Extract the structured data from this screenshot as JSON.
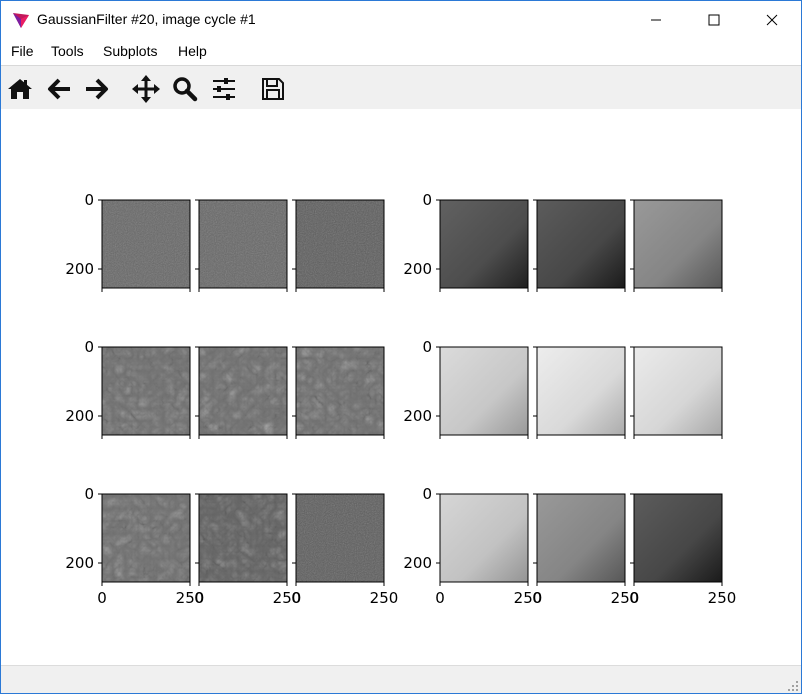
{
  "window": {
    "title": "GaussianFilter #20, image cycle #1"
  },
  "menu": {
    "file": "File",
    "tools": "Tools",
    "subplots": "Subplots",
    "help": "Help"
  },
  "toolbar": [
    "home-icon",
    "back-arrow-icon",
    "forward-arrow-icon",
    "pan-icon",
    "zoom-icon",
    "configure-subplots-icon",
    "save-icon"
  ],
  "figure": {
    "y_ticks": [
      "0",
      "200"
    ],
    "x_ticks": [
      "0",
      "250"
    ],
    "colormap": "gray",
    "panels": [
      {
        "group": "left",
        "row": 0,
        "col": 0,
        "style": "noise",
        "level": 0.4
      },
      {
        "group": "left",
        "row": 0,
        "col": 1,
        "style": "noise",
        "level": 0.4
      },
      {
        "group": "left",
        "row": 0,
        "col": 2,
        "style": "noise",
        "level": 0.36
      },
      {
        "group": "right",
        "row": 0,
        "col": 0,
        "style": "smooth",
        "level": 0.3
      },
      {
        "group": "right",
        "row": 0,
        "col": 1,
        "style": "smooth",
        "level": 0.28
      },
      {
        "group": "right",
        "row": 0,
        "col": 2,
        "style": "smooth",
        "level": 0.52
      },
      {
        "group": "left",
        "row": 1,
        "col": 0,
        "style": "texture",
        "level": 0.45
      },
      {
        "group": "left",
        "row": 1,
        "col": 1,
        "style": "texture",
        "level": 0.45
      },
      {
        "group": "left",
        "row": 1,
        "col": 2,
        "style": "texture",
        "level": 0.45
      },
      {
        "group": "right",
        "row": 1,
        "col": 0,
        "style": "smooth",
        "level": 0.78
      },
      {
        "group": "right",
        "row": 1,
        "col": 1,
        "style": "smooth",
        "level": 0.85
      },
      {
        "group": "right",
        "row": 1,
        "col": 2,
        "style": "smooth",
        "level": 0.84
      },
      {
        "group": "left",
        "row": 2,
        "col": 0,
        "style": "texture",
        "level": 0.45
      },
      {
        "group": "left",
        "row": 2,
        "col": 1,
        "style": "texture",
        "level": 0.4
      },
      {
        "group": "left",
        "row": 2,
        "col": 2,
        "style": "noise",
        "level": 0.36
      },
      {
        "group": "right",
        "row": 2,
        "col": 0,
        "style": "smooth",
        "level": 0.76
      },
      {
        "group": "right",
        "row": 2,
        "col": 1,
        "style": "smooth",
        "level": 0.52
      },
      {
        "group": "right",
        "row": 2,
        "col": 2,
        "style": "smooth",
        "level": 0.28
      }
    ]
  }
}
